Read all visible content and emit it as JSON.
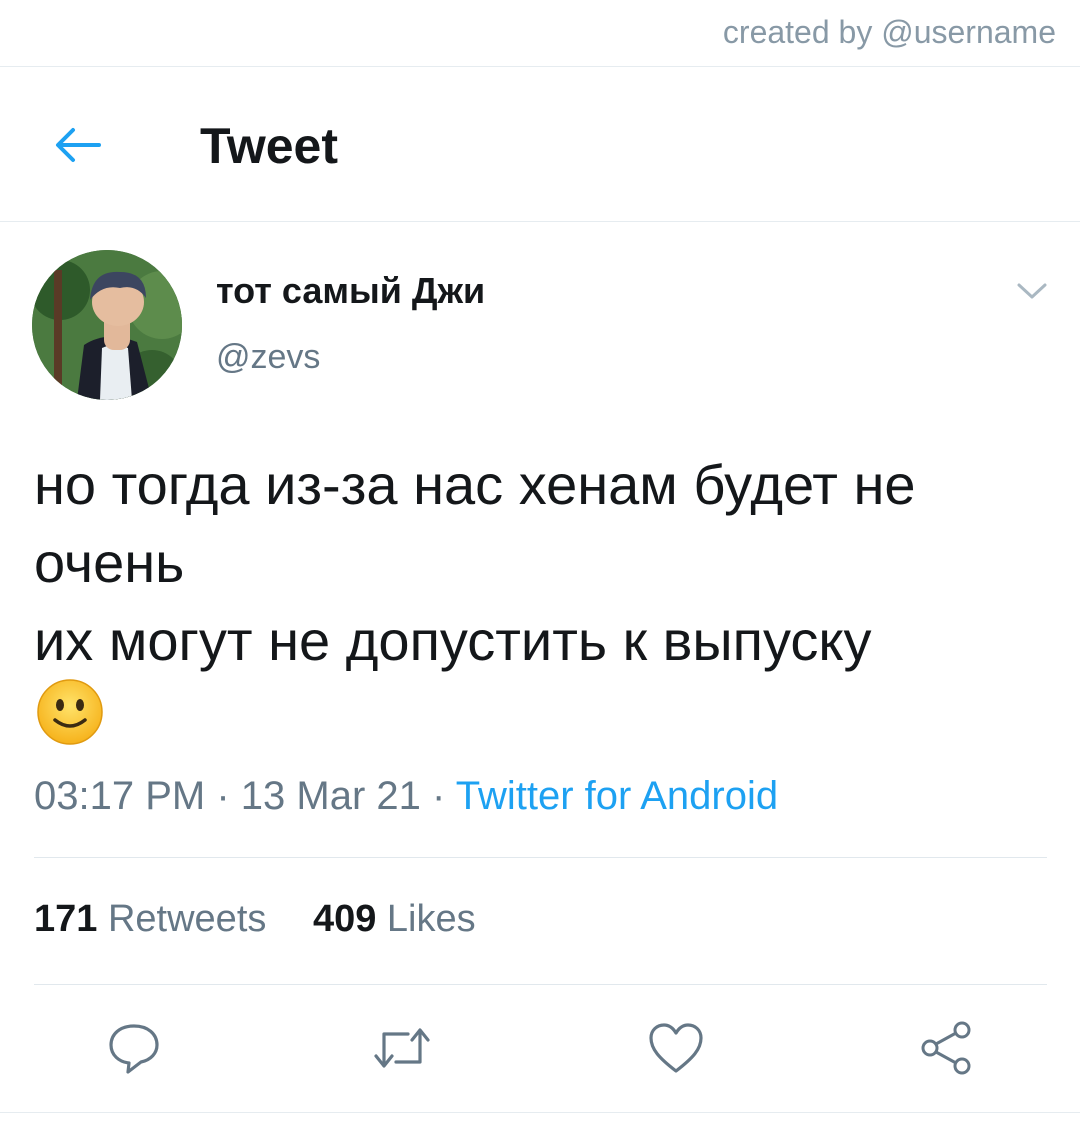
{
  "credit": "created by @username",
  "header": {
    "title": "Tweet",
    "back_icon": "arrow-left-icon"
  },
  "author": {
    "display_name": "тот самый Джи",
    "handle": "@zevs"
  },
  "tweet": {
    "lines": [
      "но тогда из-за нас хенам будет не",
      "очень",
      "их могут не допустить к выпуску"
    ],
    "emoji": "slightly-smiling-face",
    "time": "03:17 PM",
    "date": "13 Mar 21",
    "separator": "·",
    "source": "Twitter for Android"
  },
  "stats": {
    "retweets_count": "171",
    "retweets_label": "Retweets",
    "likes_count": "409",
    "likes_label": "Likes"
  },
  "actions": [
    "reply-icon",
    "retweet-icon",
    "like-icon",
    "share-icon"
  ],
  "colors": {
    "accent": "#1da1f2",
    "muted": "#657786",
    "text": "#14171a",
    "divider": "#e1e8ed"
  }
}
